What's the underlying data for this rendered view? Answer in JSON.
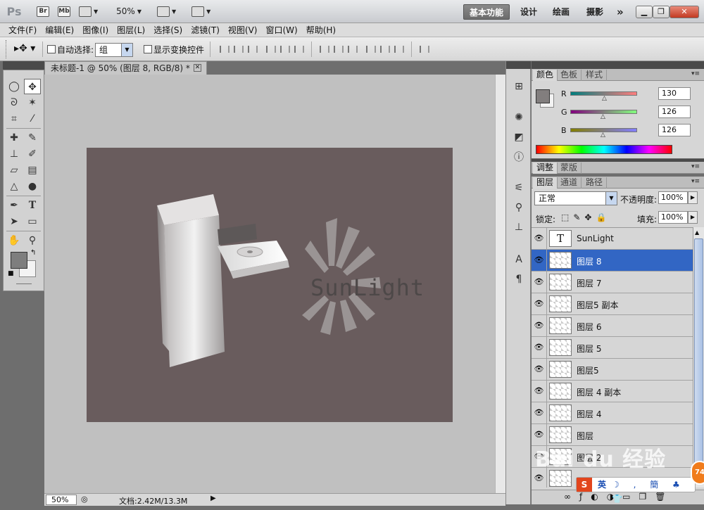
{
  "titlebar": {
    "logo": "Ps",
    "bridge": "Br",
    "minibridge": "Mb",
    "zoom": "50%",
    "workspaces": [
      "基本功能",
      "设计",
      "绘画",
      "摄影"
    ],
    "more": "»"
  },
  "menu": [
    "文件(F)",
    "编辑(E)",
    "图像(I)",
    "图层(L)",
    "选择(S)",
    "滤镜(T)",
    "视图(V)",
    "窗口(W)",
    "帮助(H)"
  ],
  "options": {
    "auto_select_label": "自动选择:",
    "auto_select_value": "组",
    "show_transform_label": "显示变换控件"
  },
  "document": {
    "tab_title": "未标题-1 @ 50% (图层 8, RGB/8) *",
    "artwork_text": "SunLight"
  },
  "status": {
    "zoom": "50%",
    "doc_info": "文档:2.42M/13.3M"
  },
  "color_panel": {
    "tabs": [
      "颜色",
      "色板",
      "样式"
    ],
    "r_label": "R",
    "r": "130",
    "g_label": "G",
    "g": "126",
    "b_label": "B",
    "b": "126",
    "foreground": "#827e7e"
  },
  "adjust_panel": {
    "tabs": [
      "调整",
      "蒙版"
    ]
  },
  "layers_panel": {
    "tabs": [
      "图层",
      "通道",
      "路径"
    ],
    "blend_mode": "正常",
    "opacity_label": "不透明度:",
    "opacity": "100%",
    "lock_label": "锁定:",
    "fill_label": "填充:",
    "fill": "100%",
    "layers": [
      {
        "name": "SunLight",
        "type": "text"
      },
      {
        "name": "图层 8",
        "type": "pixel",
        "selected": true
      },
      {
        "name": "图层 7",
        "type": "pixel"
      },
      {
        "name": "图层5 副本",
        "type": "pixel"
      },
      {
        "name": "图层 6",
        "type": "pixel"
      },
      {
        "name": "图层 5",
        "type": "pixel"
      },
      {
        "name": "图层5",
        "type": "pixel"
      },
      {
        "name": "图层 4 副本",
        "type": "pixel"
      },
      {
        "name": "图层 4",
        "type": "pixel"
      },
      {
        "name": "图层",
        "type": "pixel"
      },
      {
        "name": "图层 2",
        "type": "pixel"
      },
      {
        "name": "",
        "type": "pixel"
      }
    ]
  },
  "overlay": {
    "watermark": "Bai du 经验",
    "ime_label": "英",
    "notif_badge": "74"
  }
}
